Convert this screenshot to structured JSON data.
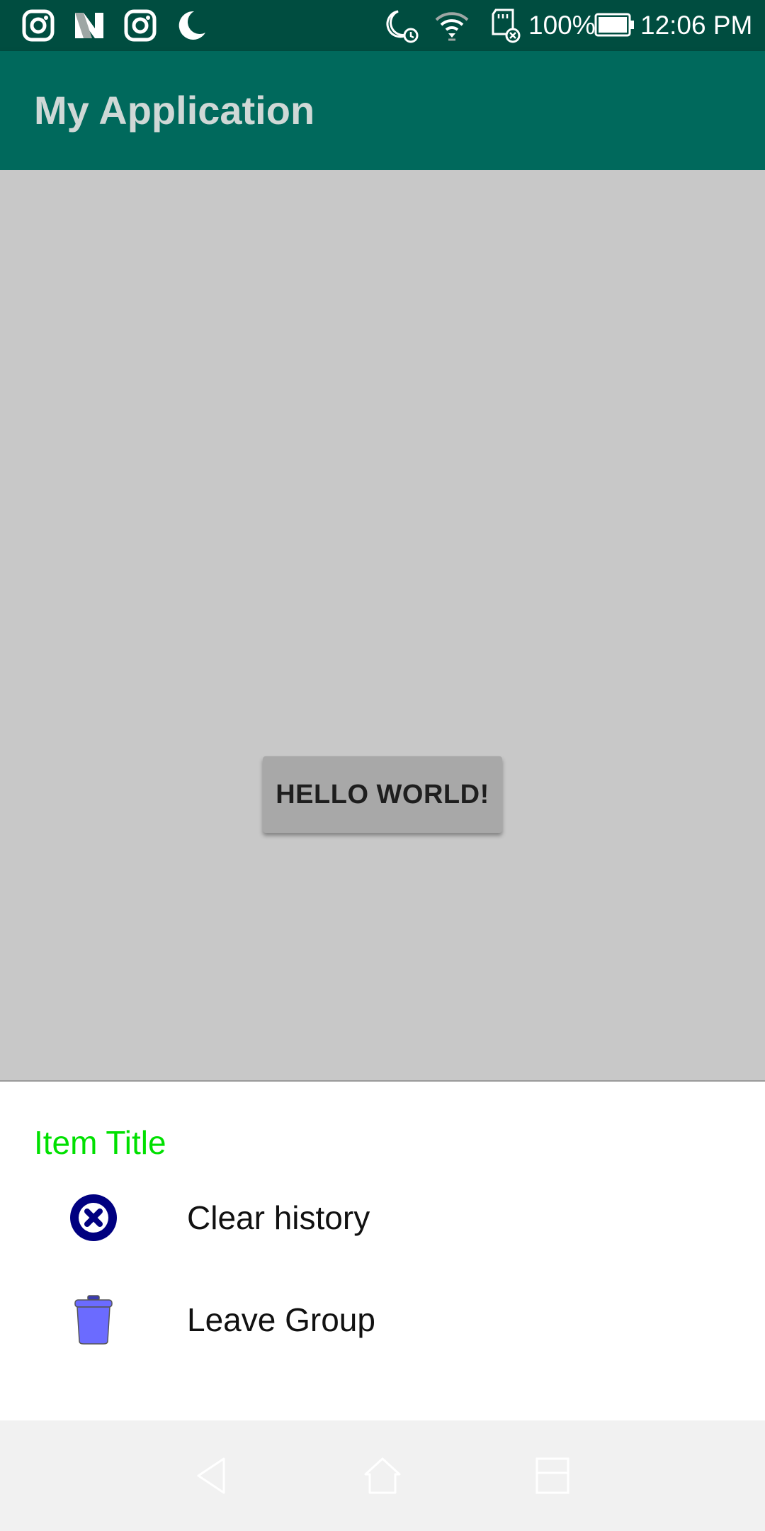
{
  "status_bar": {
    "left_icons": [
      "instagram-icon",
      "n-app-icon",
      "instagram-icon",
      "moon-icon"
    ],
    "right_icons": [
      "moon-alarm-icon",
      "wifi-icon",
      "sd-card-icon",
      "battery-icon"
    ],
    "battery_percent": "100%",
    "time": "12:06 PM"
  },
  "app_bar": {
    "title": "My Application"
  },
  "main": {
    "button_label": "HELLO WORLD!"
  },
  "bottom_sheet": {
    "title": "Item Title",
    "items": [
      {
        "label": "Clear history",
        "icon": "clear-icon"
      },
      {
        "label": "Leave Group",
        "icon": "trash-icon"
      }
    ]
  },
  "nav_bar": {
    "buttons": [
      "back-icon",
      "home-icon",
      "recents-icon"
    ]
  },
  "colors": {
    "status_bar": "#004d40",
    "app_bar": "#00695c",
    "sheet_title": "#00e000",
    "clear_icon": "#000080",
    "trash_icon": "#6b6bff"
  }
}
